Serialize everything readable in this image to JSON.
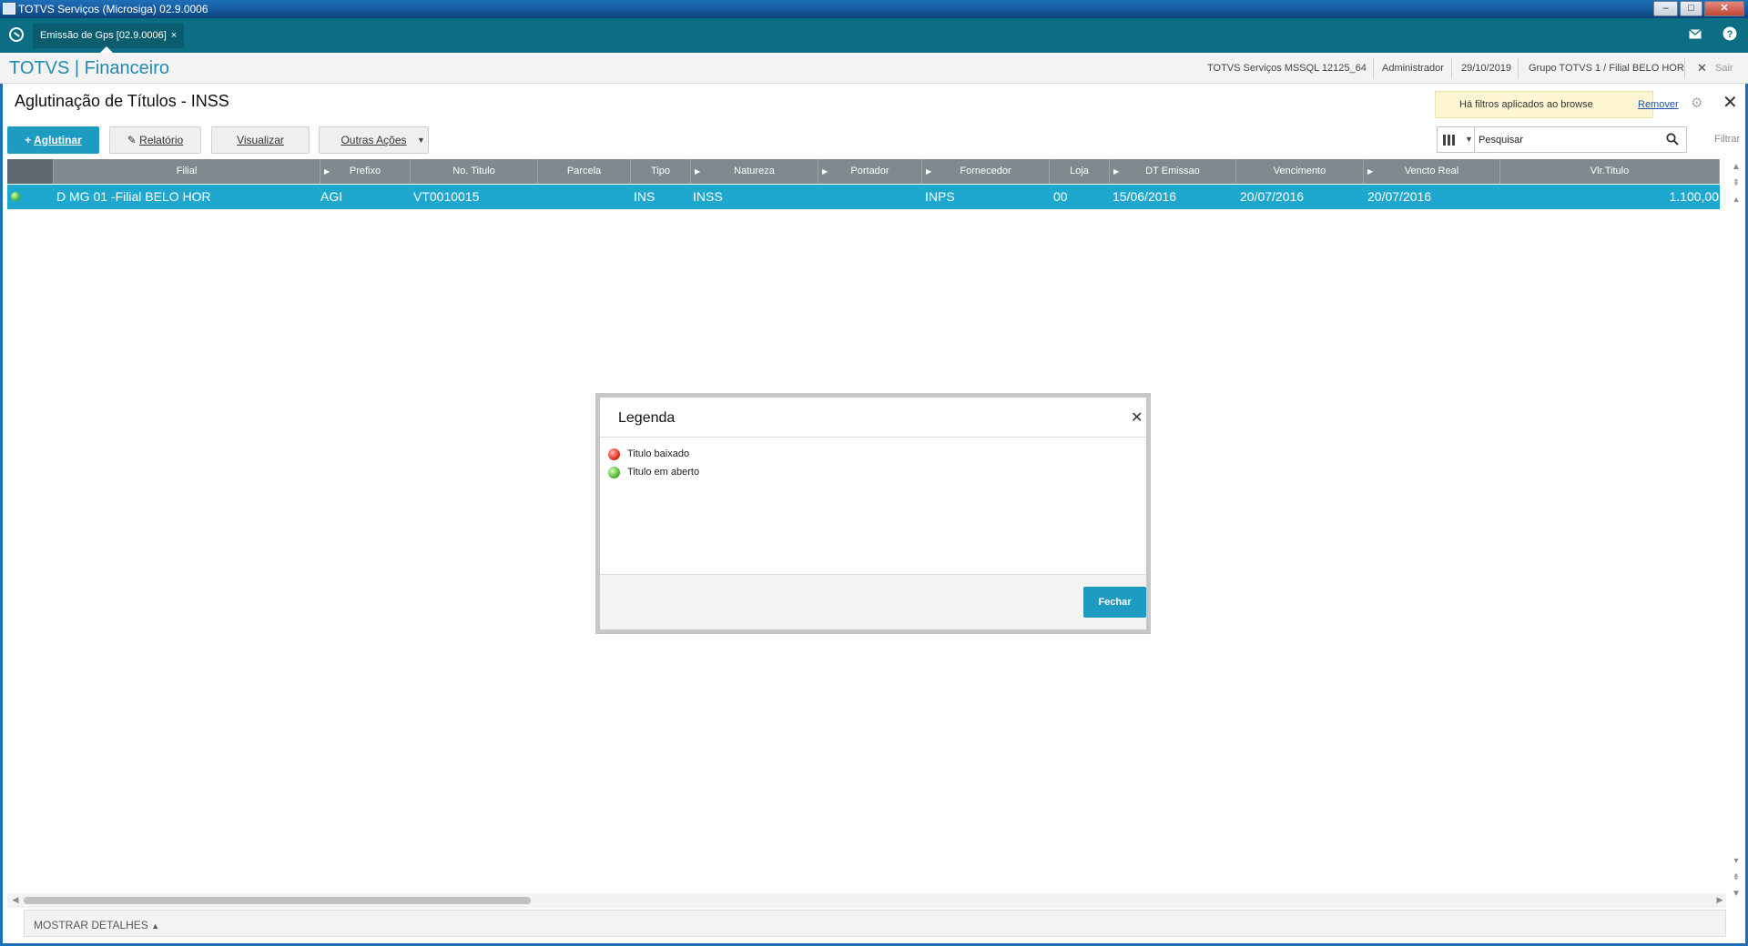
{
  "window": {
    "title": "TOTVS Serviços (Microsiga) 02.9.0006",
    "min": "‒",
    "max": "□",
    "close": "✕"
  },
  "tabbar": {
    "tab_label": "Emissão de Gps [02.9.0006]",
    "tab_close": "×",
    "mail_icon": "mail-icon",
    "help_icon": "help-icon"
  },
  "header": {
    "brand": "TOTVS | Financeiro",
    "server": "TOTVS Serviços MSSQL 12125_64",
    "user": "Administrador",
    "date": "29/10/2019",
    "group": "Grupo TOTVS 1 / Filial BELO HOR",
    "exit": "Sair"
  },
  "page": {
    "title": "Aglutinação de Títulos - INSS"
  },
  "filter_notice": {
    "text": "Há filtros aplicados ao browse",
    "remove": "Remover"
  },
  "toolbar": {
    "aglutinar": "Aglutinar",
    "relatorio": "Relatório",
    "visualizar": "Visualizar",
    "outras_acoes": "Outras Ações"
  },
  "search": {
    "placeholder": "Pesquisar",
    "filter": "Filtrar"
  },
  "grid": {
    "columns": [
      "Filial",
      "Prefixo",
      "No. Titulo",
      "Parcela",
      "Tipo",
      "Natureza",
      "Portador",
      "Fornecedor",
      "Loja",
      "DT Emissao",
      "Vencimento",
      "Vencto Real",
      "Vlr.Titulo"
    ],
    "rows": [
      {
        "status": "green",
        "filial": "D MG 01 -Filial BELO HOR",
        "prefixo": "AGI",
        "no_titulo": "VT0010015",
        "parcela": "",
        "tipo": "INS",
        "natureza": "INSS",
        "portador": "",
        "fornecedor": "INPS",
        "loja": "00",
        "dt_emissao": "15/06/2016",
        "vencimento": "20/07/2016",
        "vencto_real": "20/07/2016",
        "vlr_titulo": "1.100,00"
      }
    ]
  },
  "footer": {
    "details": "MOSTRAR DETALHES"
  },
  "modal": {
    "title": "Legenda",
    "items": [
      {
        "color": "#e0281a",
        "label": "Titulo baixado"
      },
      {
        "color": "#4ab42a",
        "label": "Titulo em aberto"
      }
    ],
    "close_button": "Fechar"
  }
}
